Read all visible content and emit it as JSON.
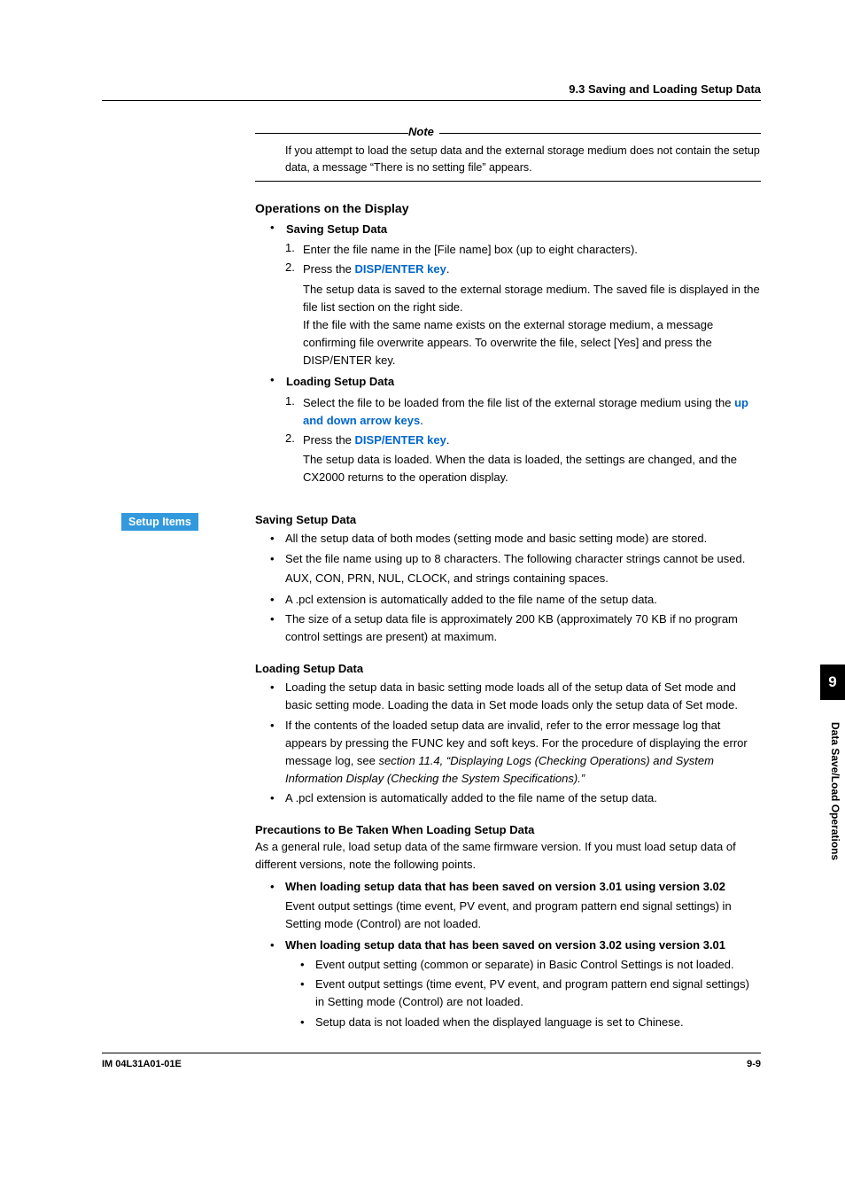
{
  "header": {
    "section_title": "9.3  Saving and Loading Setup Data"
  },
  "note": {
    "label": "Note",
    "text": "If you attempt to load the setup data and the external storage medium does not contain the setup data, a message “There is no setting file” appears."
  },
  "operations": {
    "heading": "Operations on the Display",
    "saving": {
      "title": "Saving Setup Data",
      "step1": "Enter the file name in the [File name] box (up to eight characters).",
      "step2_pre": "Press the ",
      "step2_link": "DISP/ENTER key",
      "step2_post": ".",
      "step2_body": "The setup data is saved to the external storage medium.  The saved file is displayed in the file list section on the right side.\nIf the file with the same name exists on the external storage medium, a message confirming file overwrite appears.  To overwrite the file, select [Yes] and press the DISP/ENTER key."
    },
    "loading": {
      "title": "Loading Setup Data",
      "step1_pre": "Select the file to be loaded from the file list of the external storage medium using the ",
      "step1_link": "up and down arrow keys",
      "step1_post": ".",
      "step2_pre": "Press the ",
      "step2_link": "DISP/ENTER key",
      "step2_post": ".",
      "step2_body": "The setup data is loaded.  When the data is loaded, the settings are changed, and the CX2000 returns to the operation display."
    }
  },
  "setup_items": {
    "badge": "Setup Items",
    "saving": {
      "heading": "Saving Setup Data",
      "b1": "All the setup data of both modes (setting mode and basic setting mode) are stored.",
      "b2": "Set the file name using up to 8 characters.  The following character strings cannot be used.",
      "b2_sub": "AUX, CON, PRN, NUL, CLOCK, and strings containing spaces.",
      "b3": "A .pcl extension is automatically added to the file name of the setup data.",
      "b4": "The size of a setup data file is approximately 200 KB (approximately 70 KB if no program control settings are present) at maximum."
    },
    "loading": {
      "heading": "Loading Setup Data",
      "b1": "Loading the setup data in basic setting mode loads all of the setup data of Set mode and basic setting mode.  Loading the data in Set mode loads only the setup data of Set mode.",
      "b2_pre": "If the contents of the loaded setup data are invalid, refer to the error message log that appears by pressing the FUNC key and soft keys.  For the procedure of displaying the error message log, see ",
      "b2_italic": "section 11.4, “Displaying Logs (Checking Operations) and System Information Display (Checking the System Specifications).”",
      "b3": "A .pcl extension is automatically added to the file name of the setup data."
    },
    "precautions": {
      "heading": "Precautions to Be Taken When Loading Setup Data",
      "intro": "As a general rule, load setup data of the same firmware version. If you must load setup data of different versions, note the following points.",
      "p1_title": "When loading setup data that has been saved on version 3.01 using version 3.02",
      "p1_body": "Event output settings (time event, PV event, and program pattern end signal settings) in Setting mode (Control) are not loaded.",
      "p2_title": "When loading setup data that has been saved on version 3.02 using version 3.01",
      "p2_s1": "Event output setting (common or separate) in Basic Control Settings is not loaded.",
      "p2_s2": "Event output settings (time event, PV event, and program pattern end signal settings) in Setting mode (Control) are not loaded.",
      "p2_s3": "Setup data is not loaded when the displayed language is set to Chinese."
    }
  },
  "footer": {
    "doc_id": "IM 04L31A01-01E",
    "page": "9-9"
  },
  "sidebar": {
    "chapter": "9",
    "label": "Data Save/Load Operations"
  }
}
